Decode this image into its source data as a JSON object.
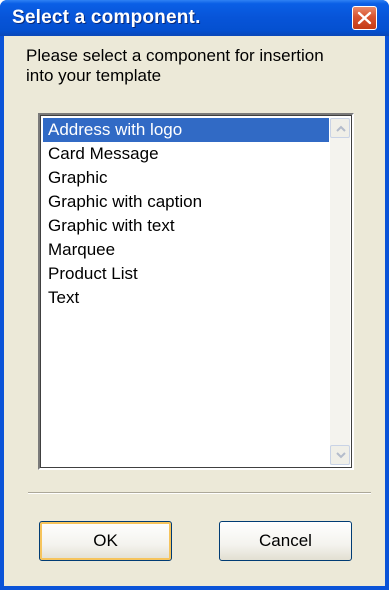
{
  "window": {
    "title": "Select a component."
  },
  "dialog": {
    "prompt": "Please select a component for insertion into your template"
  },
  "components": {
    "selected_index": 0,
    "items": [
      {
        "label": "Address with logo"
      },
      {
        "label": "Card Message"
      },
      {
        "label": "Graphic"
      },
      {
        "label": "Graphic with caption"
      },
      {
        "label": "Graphic with text"
      },
      {
        "label": "Marquee"
      },
      {
        "label": "Product List"
      },
      {
        "label": "Text"
      }
    ]
  },
  "buttons": {
    "ok_label": "OK",
    "cancel_label": "Cancel"
  },
  "colors": {
    "titlebar": "#0754d8",
    "selection": "#316ac5",
    "dialog_background": "#ece9d8",
    "close_button": "#d8532f"
  },
  "icons": {
    "close": "close-icon",
    "scroll_up": "scroll-up-arrow-icon",
    "scroll_down": "scroll-down-arrow-icon"
  }
}
